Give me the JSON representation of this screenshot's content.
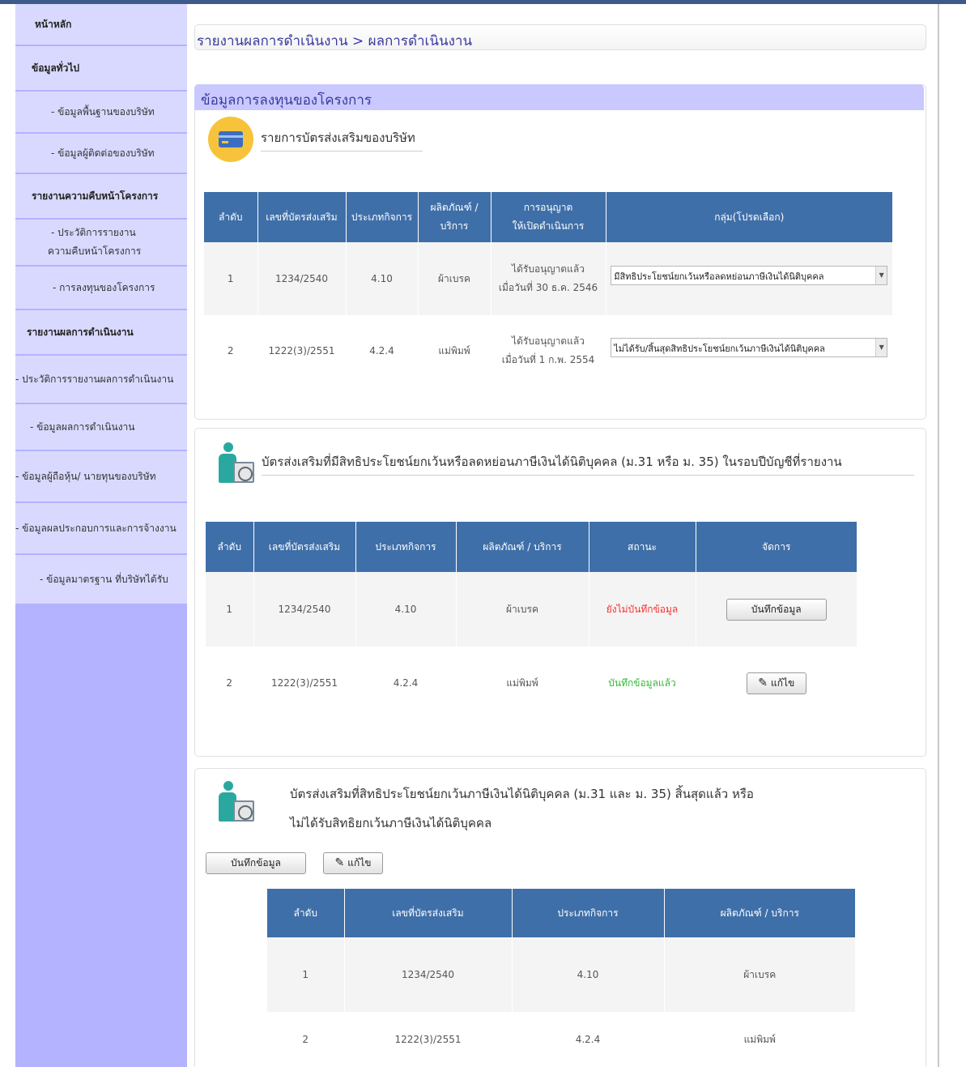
{
  "sidebar": {
    "items": [
      {
        "label": "หน้าหลัก"
      },
      {
        "label": "ข้อมูลทั่วไป"
      },
      {
        "label": "- ข้อมูลพื้นฐานของบริษัท"
      },
      {
        "label": "- ข้อมูลผู้ติดต่อของบริษัท"
      },
      {
        "label": "รายงานความคืบหน้าโครงการ"
      },
      {
        "label": "- ประวัติการรายงาน",
        "label2": "ความคืบหน้าโครงการ"
      },
      {
        "label": "- การลงทุนของโครงการ"
      },
      {
        "label": "รายงานผลการดำเนินงาน"
      },
      {
        "label": "- ประวัติการรายงานผลการดำเนินงาน"
      },
      {
        "label": "- ข้อมูลผลการดำเนินงาน"
      },
      {
        "label": "- ข้อมูลผู้ถือหุ้น/ นายทุนของบริษัท"
      },
      {
        "label": "- ข้อมูลผลประกอบการและการจ้างงาน"
      },
      {
        "label": "- ข้อมูลมาตรฐาน ที่บริษัทได้รับ"
      }
    ]
  },
  "breadcrumb": "รายงานผลการดำเนินงาน > ผลการดำเนินงาน",
  "panel1": {
    "header": "ข้อมูลการลงทุนของโครงการ",
    "section_title": "รายการบัตรส่งเสริมของบริษัท",
    "table": {
      "headers": [
        "ลำดับ",
        "เลขที่บัตรส่งเสริม",
        "ประเภทกิจการ",
        "ผลิตภัณฑ์ /",
        "การอนุญาต",
        "กลุ่ม(โปรดเลือก)"
      ],
      "headers2": [
        "",
        "",
        "",
        "บริการ",
        "ให้เปิดดำเนินการ",
        ""
      ],
      "rows": [
        {
          "no": "1",
          "card": "1234/2540",
          "type": "4.10",
          "product": "ผ้าเบรค",
          "permit1": "ได้รับอนุญาตแล้ว",
          "permit2": "เมื่อวันที่ 30 ธ.ค. 2546",
          "group": "มีสิทธิประโยชน์ยกเว้นหรือลดหย่อนภาษีเงินได้นิติบุคคล"
        },
        {
          "no": "2",
          "card": "1222(3)/2551",
          "type": "4.2.4",
          "product": "แม่พิมพ์",
          "permit1": "ได้รับอนุญาตแล้ว",
          "permit2": "เมื่อวันที่ 1 ก.พ. 2554",
          "group": "ไม่ได้รับ/สิ้นสุดสิทธิประโยชน์ยกเว้นภาษีเงินได้นิติบุคคล"
        }
      ]
    }
  },
  "panel2": {
    "title": "บัตรส่งเสริมที่มีสิทธิประโยชน์ยกเว้นหรือลดหย่อนภาษีเงินได้นิติบุคคล (ม.31 หรือ ม. 35) ในรอบปีบัญชีที่รายงาน",
    "table": {
      "headers": [
        "ลำดับ",
        "เลขที่บัตรส่งเสริม",
        "ประเภทกิจการ",
        "ผลิตภัณฑ์ / บริการ",
        "สถานะ",
        "จัดการ"
      ],
      "rows": [
        {
          "no": "1",
          "card": "1234/2540",
          "type": "4.10",
          "product": "ผ้าเบรค",
          "status": "ยังไม่บันทึกข้อมูล",
          "action": "บันทึกข้อมูล"
        },
        {
          "no": "2",
          "card": "1222(3)/2551",
          "type": "4.2.4",
          "product": "แม่พิมพ์",
          "status": "บันทึกข้อมูลแล้ว",
          "action": "แก้ไข"
        }
      ]
    }
  },
  "panel3": {
    "title_line1": "บัตรส่งเสริมที่สิทธิประโยชน์ยกเว้นภาษีเงินได้นิติบุคคล (ม.31 และ ม. 35) สิ้นสุดแล้ว หรือ",
    "title_line2": "ไม่ได้รับสิทธิยกเว้นภาษีเงินได้นิติบุคคล",
    "save_label": "บันทึกข้อมูล",
    "edit_label": "แก้ไข",
    "table": {
      "headers": [
        "ลำดับ",
        "เลขที่บัตรส่งเสริม",
        "ประเภทกิจการ",
        "ผลิตภัณฑ์ / บริการ"
      ],
      "rows": [
        {
          "no": "1",
          "card": "1234/2540",
          "type": "4.10",
          "product": "ผ้าเบรค"
        },
        {
          "no": "2",
          "card": "1222(3)/2551",
          "type": "4.2.4",
          "product": "แม่พิมพ์"
        }
      ]
    }
  },
  "colors": {
    "sidebar_bg": "#b3b3ff",
    "sidebar_item": "#d9d9ff",
    "table_header": "#3f6fa8",
    "panel_header": "#c9c9ff",
    "status_pending": "#ff3030",
    "status_done": "#33bb33"
  },
  "icons": [
    "credit-card-icon",
    "person-document-icon",
    "pencil-icon",
    "dropdown-arrow-icon"
  ]
}
